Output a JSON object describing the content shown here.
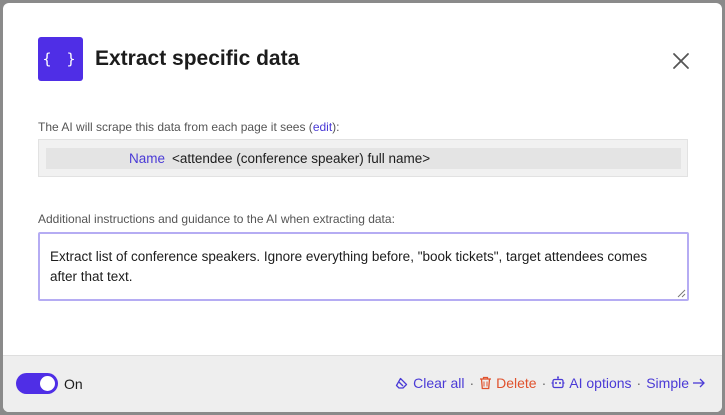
{
  "header": {
    "icon_text": "{ }",
    "title": "Extract specific data"
  },
  "scrape": {
    "label_prefix": "The AI will scrape this data from each page it sees (",
    "edit_link": "edit",
    "label_suffix": "):",
    "fields": [
      {
        "name": "Name",
        "description": "<attendee (conference speaker) full name>"
      }
    ]
  },
  "instructions": {
    "label": "Additional instructions and guidance to the AI when extracting data:",
    "value": "Extract list of conference speakers. Ignore everything before, \"book tickets\", target attendees comes after that text."
  },
  "footer": {
    "toggle_state": "on",
    "toggle_label": "On",
    "separator": "·",
    "actions": {
      "clear_all": "Clear all",
      "delete": "Delete",
      "ai_options": "AI options",
      "simple": "Simple"
    }
  },
  "colors": {
    "accent": "#4f2ee6",
    "link": "#4a3ad6",
    "danger": "#e0522d",
    "focus_border": "#b5acf3"
  },
  "icons": [
    "braces-icon",
    "close-icon",
    "eraser-icon",
    "trash-icon",
    "robot-icon",
    "arrow-right-icon"
  ]
}
